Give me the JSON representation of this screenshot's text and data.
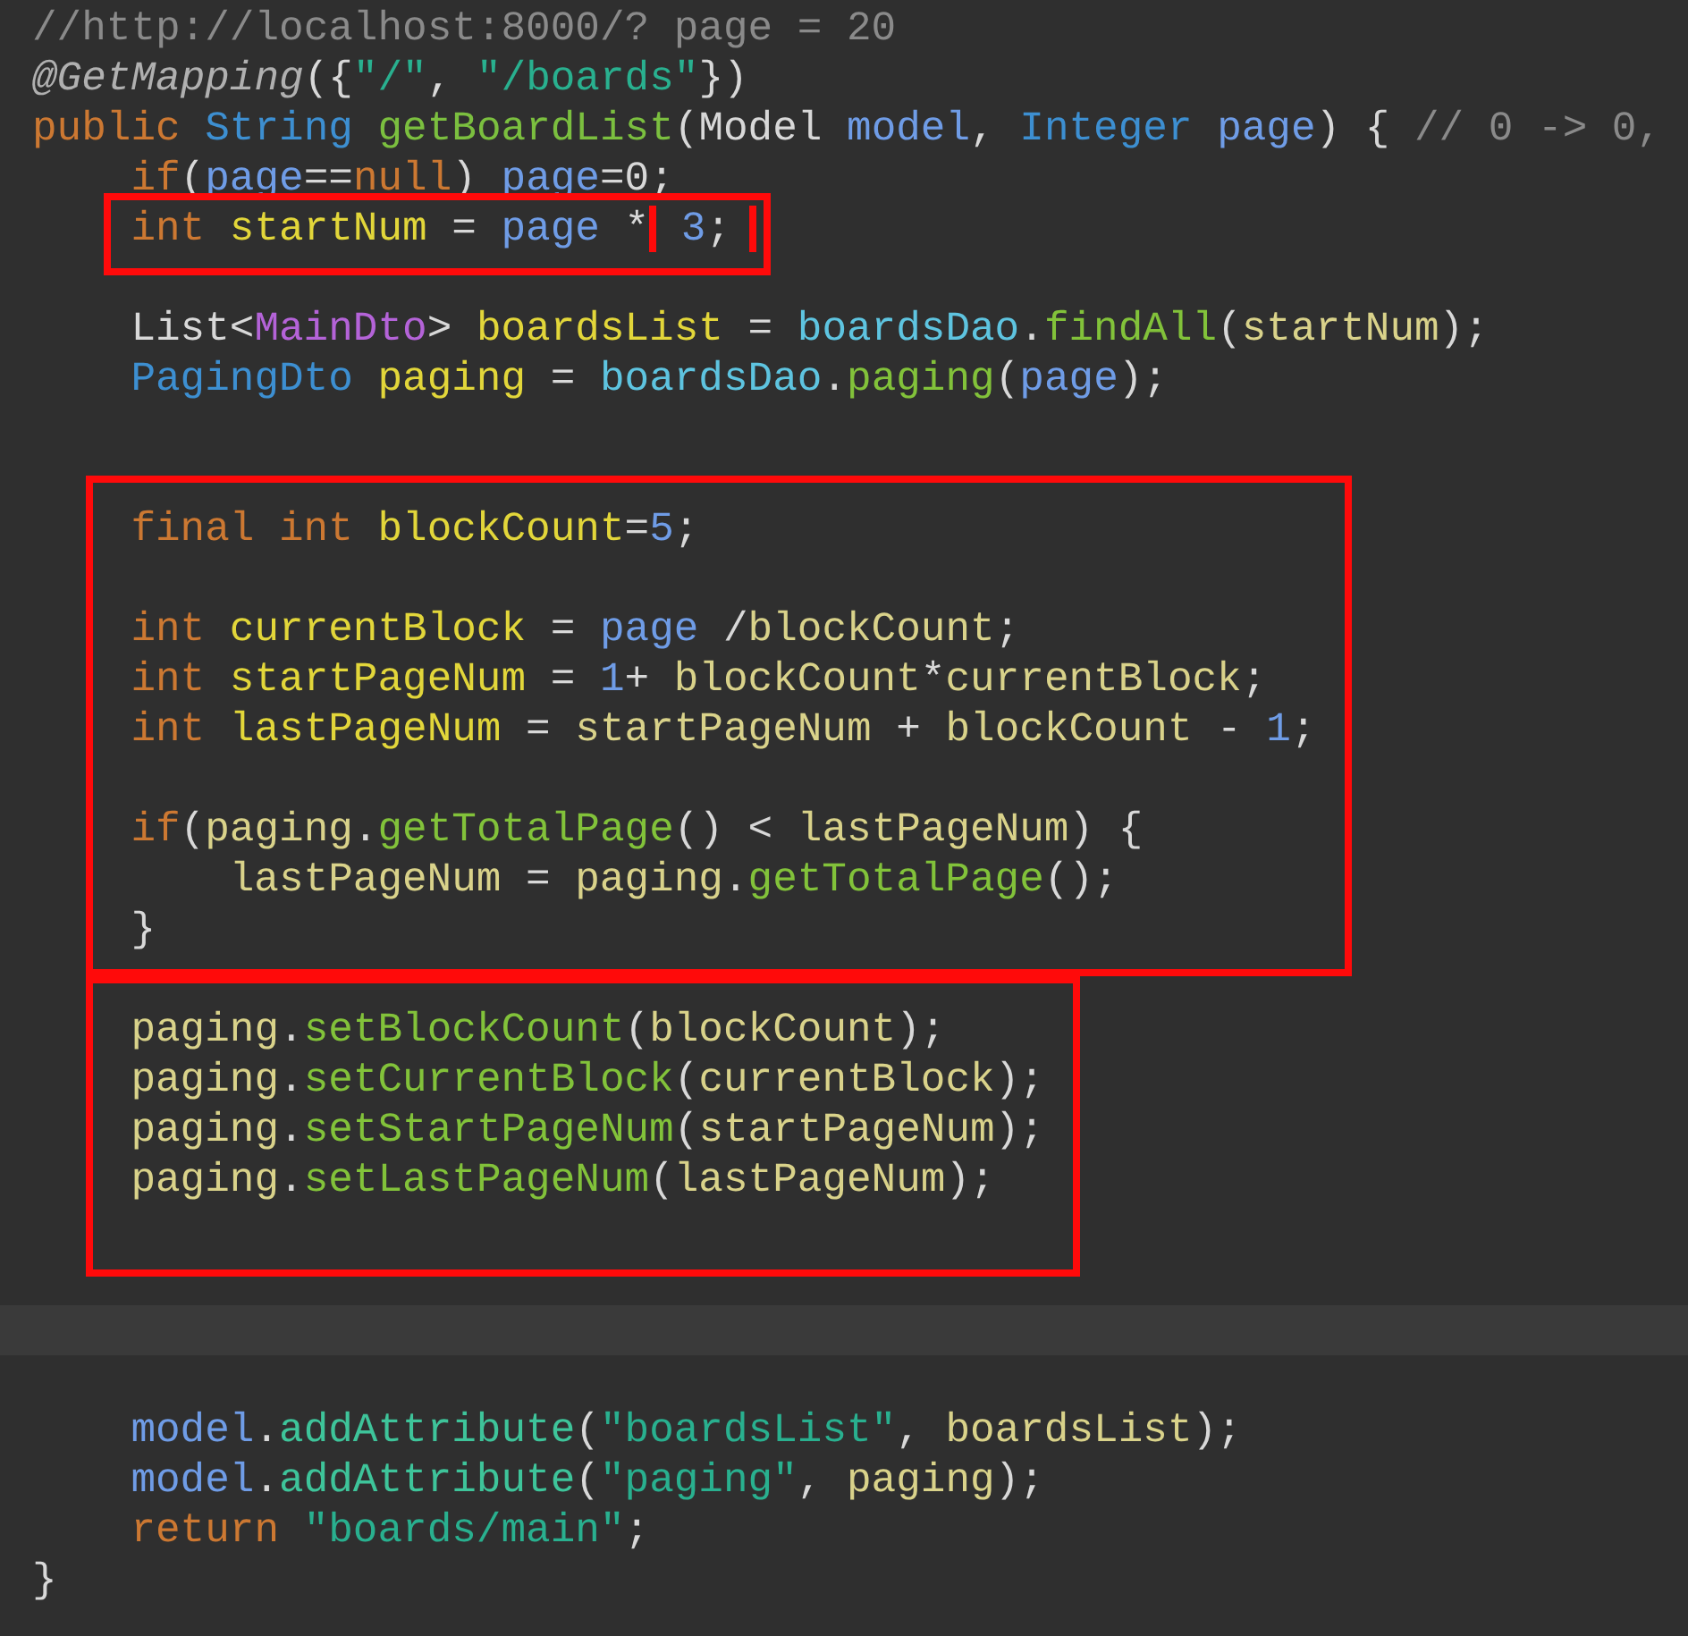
{
  "editor": {
    "lines": [
      {
        "kind": "code",
        "tokens": [
          {
            "text": "//http://localhost:8000/? page = 20",
            "kind": "comment"
          }
        ]
      },
      {
        "kind": "code",
        "tokens": [
          {
            "text": "@GetMapping",
            "kind": "anno"
          },
          {
            "text": "({",
            "kind": "plain"
          },
          {
            "text": "\"/\"",
            "kind": "str"
          },
          {
            "text": ", ",
            "kind": "plain"
          },
          {
            "text": "\"/boards\"",
            "kind": "str"
          },
          {
            "text": "})",
            "kind": "plain"
          }
        ]
      },
      {
        "kind": "code",
        "tokens": [
          {
            "text": "public ",
            "kind": "kw"
          },
          {
            "text": "String ",
            "kind": "type"
          },
          {
            "text": "getBoardList",
            "kind": "fn"
          },
          {
            "text": "(Model ",
            "kind": "plain"
          },
          {
            "text": "model",
            "kind": "param"
          },
          {
            "text": ", ",
            "kind": "plain"
          },
          {
            "text": "Integer ",
            "kind": "type"
          },
          {
            "text": "page",
            "kind": "param"
          },
          {
            "text": ") { ",
            "kind": "plain"
          },
          {
            "text": "// 0 -> 0,",
            "kind": "comment"
          }
        ],
        "children": [
          {
            "kind": "code",
            "tokens": [
              {
                "text": "if",
                "kind": "kw"
              },
              {
                "text": "(",
                "kind": "plain"
              },
              {
                "text": "page",
                "kind": "param"
              },
              {
                "text": "==",
                "kind": "plain"
              },
              {
                "text": "null",
                "kind": "kw"
              },
              {
                "text": ") ",
                "kind": "plain"
              },
              {
                "text": "page",
                "kind": "param"
              },
              {
                "text": "=0;",
                "kind": "plain"
              }
            ]
          },
          {
            "kind": "framed",
            "tokens": [
              {
                "text": "int ",
                "kind": "kw"
              },
              {
                "text": "startNum",
                "kind": "var"
              },
              {
                "text": " = ",
                "kind": "plain"
              },
              {
                "text": "page",
                "kind": "param"
              },
              {
                "text": " *",
                "kind": "plain"
              },
              {
                "kind": "frame",
                "tokens": [
                  {
                    "text": " 3",
                    "kind": "num"
                  },
                  {
                    "text": ";",
                    "kind": "plain"
                  }
                ]
              }
            ]
          },
          {
            "kind": "blank"
          },
          {
            "kind": "code",
            "tokens": [
              {
                "text": "List<",
                "kind": "plain"
              },
              {
                "text": "MainDto",
                "kind": "cls"
              },
              {
                "text": "> ",
                "kind": "plain"
              },
              {
                "text": "boardsList",
                "kind": "var"
              },
              {
                "text": " = ",
                "kind": "plain"
              },
              {
                "text": "boardsDao",
                "kind": "field"
              },
              {
                "text": ".",
                "kind": "plain"
              },
              {
                "text": "findAll",
                "kind": "call"
              },
              {
                "text": "(",
                "kind": "plain"
              },
              {
                "text": "startNum",
                "kind": "local"
              },
              {
                "text": ");",
                "kind": "plain"
              }
            ]
          },
          {
            "kind": "code",
            "tokens": [
              {
                "text": "PagingDto ",
                "kind": "type"
              },
              {
                "text": "paging",
                "kind": "var"
              },
              {
                "text": " = ",
                "kind": "plain"
              },
              {
                "text": "boardsDao",
                "kind": "field"
              },
              {
                "text": ".",
                "kind": "plain"
              },
              {
                "text": "paging",
                "kind": "call"
              },
              {
                "text": "(",
                "kind": "plain"
              },
              {
                "text": "page",
                "kind": "param"
              },
              {
                "text": ");",
                "kind": "plain"
              }
            ]
          },
          {
            "kind": "blank"
          },
          {
            "kind": "blank"
          },
          {
            "kind": "framed_group",
            "children": [
              {
                "kind": "code",
                "tokens": [
                  {
                    "text": "final int ",
                    "kind": "kw"
                  },
                  {
                    "text": "blockCount",
                    "kind": "var"
                  },
                  {
                    "text": "=",
                    "kind": "plain"
                  },
                  {
                    "text": "5",
                    "kind": "num"
                  },
                  {
                    "text": ";",
                    "kind": "plain"
                  }
                ]
              },
              {
                "kind": "blank"
              },
              {
                "kind": "code",
                "tokens": [
                  {
                    "text": "int ",
                    "kind": "kw"
                  },
                  {
                    "text": "currentBlock",
                    "kind": "var"
                  },
                  {
                    "text": " = ",
                    "kind": "plain"
                  },
                  {
                    "text": "page",
                    "kind": "param"
                  },
                  {
                    "text": " /",
                    "kind": "plain"
                  },
                  {
                    "text": "blockCount",
                    "kind": "local"
                  },
                  {
                    "text": ";",
                    "kind": "plain"
                  }
                ]
              },
              {
                "kind": "code",
                "tokens": [
                  {
                    "text": "int ",
                    "kind": "kw"
                  },
                  {
                    "text": "startPageNum",
                    "kind": "var"
                  },
                  {
                    "text": " = ",
                    "kind": "plain"
                  },
                  {
                    "text": "1",
                    "kind": "num"
                  },
                  {
                    "text": "+ ",
                    "kind": "plain"
                  },
                  {
                    "text": "blockCount",
                    "kind": "local"
                  },
                  {
                    "text": "*",
                    "kind": "plain"
                  },
                  {
                    "text": "currentBlock",
                    "kind": "local"
                  },
                  {
                    "text": ";",
                    "kind": "plain"
                  }
                ]
              },
              {
                "kind": "code",
                "tokens": [
                  {
                    "text": "int ",
                    "kind": "kw"
                  },
                  {
                    "text": "lastPageNum",
                    "kind": "var"
                  },
                  {
                    "text": " = ",
                    "kind": "plain"
                  },
                  {
                    "text": "startPageNum",
                    "kind": "local"
                  },
                  {
                    "text": " + ",
                    "kind": "plain"
                  },
                  {
                    "text": "blockCount",
                    "kind": "local"
                  },
                  {
                    "text": " - ",
                    "kind": "plain"
                  },
                  {
                    "text": "1",
                    "kind": "num"
                  },
                  {
                    "text": ";",
                    "kind": "plain"
                  }
                ]
              },
              {
                "kind": "blank"
              },
              {
                "kind": "code",
                "tokens": [
                  {
                    "text": "if",
                    "kind": "kw"
                  },
                  {
                    "text": "(",
                    "kind": "plain"
                  },
                  {
                    "text": "paging",
                    "kind": "local"
                  },
                  {
                    "text": ".",
                    "kind": "plain"
                  },
                  {
                    "text": "getTotalPage",
                    "kind": "call"
                  },
                  {
                    "text": "() < ",
                    "kind": "plain"
                  },
                  {
                    "text": "lastPageNum",
                    "kind": "local"
                  },
                  {
                    "text": ") {",
                    "kind": "plain"
                  }
                ],
                "children": [
                  {
                    "kind": "code",
                    "tokens": [
                      {
                        "text": "lastPageNum",
                        "kind": "local"
                      },
                      {
                        "text": " = ",
                        "kind": "plain"
                      },
                      {
                        "text": "paging",
                        "kind": "local"
                      },
                      {
                        "text": ".",
                        "kind": "plain"
                      },
                      {
                        "text": "getTotalPage",
                        "kind": "call"
                      },
                      {
                        "text": "();",
                        "kind": "plain"
                      }
                    ]
                  }
                ]
              },
              {
                "kind": "code",
                "tokens": [
                  {
                    "text": "}",
                    "kind": "plain"
                  }
                ]
              }
            ]
          },
          {
            "kind": "blank"
          },
          {
            "kind": "framed_group",
            "children": [
              {
                "kind": "code",
                "tokens": [
                  {
                    "text": "paging",
                    "kind": "local"
                  },
                  {
                    "text": ".",
                    "kind": "plain"
                  },
                  {
                    "text": "setBlockCount",
                    "kind": "call"
                  },
                  {
                    "text": "(",
                    "kind": "plain"
                  },
                  {
                    "text": "blockCount",
                    "kind": "local"
                  },
                  {
                    "text": ");",
                    "kind": "plain"
                  }
                ]
              },
              {
                "kind": "code",
                "tokens": [
                  {
                    "text": "paging",
                    "kind": "local"
                  },
                  {
                    "text": ".",
                    "kind": "plain"
                  },
                  {
                    "text": "setCurrentBlock",
                    "kind": "call"
                  },
                  {
                    "text": "(",
                    "kind": "plain"
                  },
                  {
                    "text": "currentBlock",
                    "kind": "local"
                  },
                  {
                    "text": ");",
                    "kind": "plain"
                  }
                ]
              },
              {
                "kind": "code",
                "tokens": [
                  {
                    "text": "paging",
                    "kind": "local"
                  },
                  {
                    "text": ".",
                    "kind": "plain"
                  },
                  {
                    "text": "setStartPageNum",
                    "kind": "call"
                  },
                  {
                    "text": "(",
                    "kind": "plain"
                  },
                  {
                    "text": "startPageNum",
                    "kind": "local"
                  },
                  {
                    "text": ");",
                    "kind": "plain"
                  }
                ]
              },
              {
                "kind": "code",
                "tokens": [
                  {
                    "text": "paging",
                    "kind": "local"
                  },
                  {
                    "text": ".",
                    "kind": "plain"
                  },
                  {
                    "text": "setLastPageNum",
                    "kind": "call"
                  },
                  {
                    "text": "(",
                    "kind": "plain"
                  },
                  {
                    "text": "lastPageNum",
                    "kind": "local"
                  },
                  {
                    "text": ");",
                    "kind": "plain"
                  }
                ]
              },
              {
                "kind": "blank"
              }
            ]
          },
          {
            "kind": "blank"
          },
          {
            "kind": "current"
          },
          {
            "kind": "blank"
          },
          {
            "kind": "code",
            "tokens": [
              {
                "text": "model",
                "kind": "param"
              },
              {
                "text": ".",
                "kind": "plain"
              },
              {
                "text": "addAttribute",
                "kind": "call2"
              },
              {
                "text": "(",
                "kind": "plain"
              },
              {
                "text": "\"boardsList\"",
                "kind": "str"
              },
              {
                "text": ", ",
                "kind": "plain"
              },
              {
                "text": "boardsList",
                "kind": "local"
              },
              {
                "text": ");",
                "kind": "plain"
              }
            ]
          },
          {
            "kind": "code",
            "tokens": [
              {
                "text": "model",
                "kind": "param"
              },
              {
                "text": ".",
                "kind": "plain"
              },
              {
                "text": "addAttribute",
                "kind": "call2"
              },
              {
                "text": "(",
                "kind": "plain"
              },
              {
                "text": "\"paging\"",
                "kind": "str"
              },
              {
                "text": ", ",
                "kind": "plain"
              },
              {
                "text": "paging",
                "kind": "local"
              },
              {
                "text": ");",
                "kind": "plain"
              }
            ]
          },
          {
            "kind": "code",
            "tokens": [
              {
                "text": "return ",
                "kind": "kw"
              },
              {
                "text": "\"boards/main\"",
                "kind": "str"
              },
              {
                "text": ";",
                "kind": "plain"
              }
            ]
          }
        ]
      },
      {
        "kind": "code",
        "tokens": [
          {
            "text": "}",
            "kind": "plain"
          }
        ]
      }
    ]
  }
}
